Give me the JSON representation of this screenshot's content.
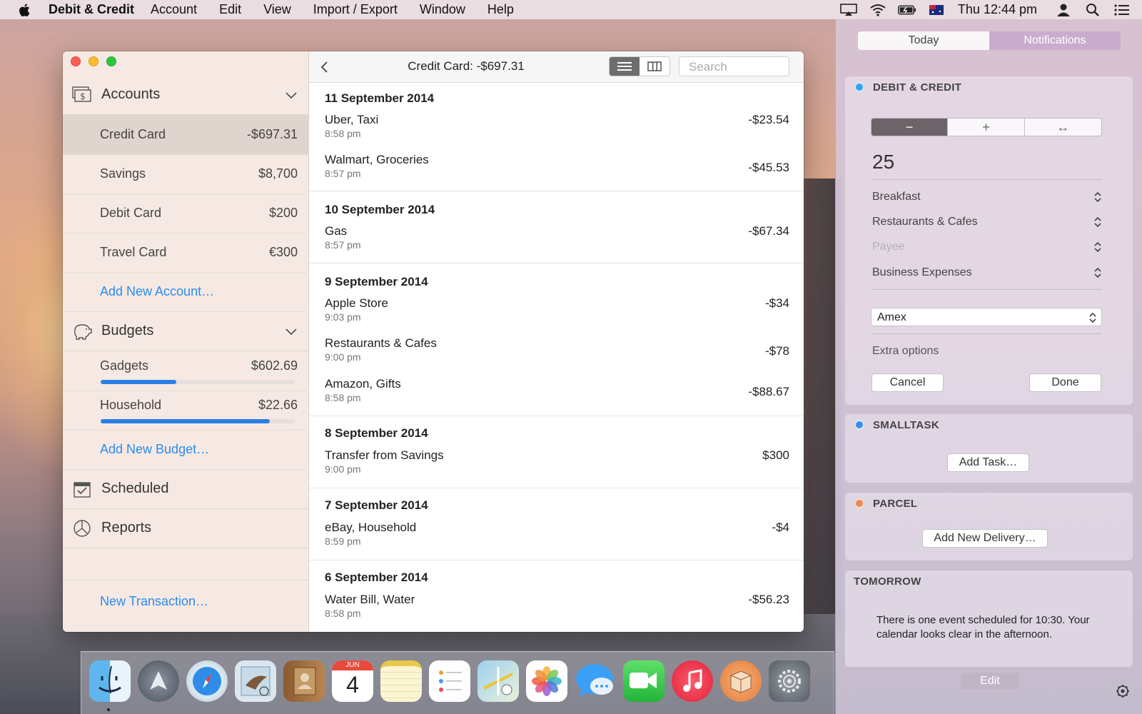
{
  "menubar": {
    "app_name": "Debit & Credit",
    "menus": [
      "Account",
      "Edit",
      "View",
      "Import / Export",
      "Window",
      "Help"
    ],
    "clock": "Thu 12:44 pm"
  },
  "window": {
    "title": "Credit Card: -$697.31",
    "search_placeholder": "Search"
  },
  "sidebar": {
    "accounts_title": "Accounts",
    "accounts": [
      {
        "label": "Credit Card",
        "amount": "-$697.31"
      },
      {
        "label": "Savings",
        "amount": "$8,700"
      },
      {
        "label": "Debit Card",
        "amount": "$200"
      },
      {
        "label": "Travel Card",
        "amount": "€300"
      }
    ],
    "add_account": "Add New Account…",
    "budgets_title": "Budgets",
    "budgets": [
      {
        "label": "Gadgets",
        "amount": "$602.69",
        "progress": 0.39
      },
      {
        "label": "Household",
        "amount": "$22.66",
        "progress": 0.87
      }
    ],
    "add_budget": "Add New Budget…",
    "scheduled": "Scheduled",
    "reports": "Reports",
    "new_transaction": "New Transaction…"
  },
  "transactions": [
    {
      "date": "11 September 2014",
      "items": [
        {
          "name": "Uber, Taxi",
          "time": "8:58 pm",
          "amount": "-$23.54"
        },
        {
          "name": "Walmart, Groceries",
          "time": "8:57 pm",
          "amount": "-$45.53"
        }
      ]
    },
    {
      "date": "10 September 2014",
      "items": [
        {
          "name": "Gas",
          "time": "8:57 pm",
          "amount": "-$67.34"
        }
      ]
    },
    {
      "date": "9 September 2014",
      "items": [
        {
          "name": "Apple Store",
          "time": "9:03 pm",
          "amount": "-$34"
        },
        {
          "name": "Restaurants & Cafes",
          "time": "9:00 pm",
          "amount": "-$78"
        },
        {
          "name": "Amazon, Gifts",
          "time": "8:58 pm",
          "amount": "-$88.67"
        }
      ]
    },
    {
      "date": "8 September 2014",
      "items": [
        {
          "name": "Transfer from Savings",
          "time": "9:00 pm",
          "amount": "$300"
        }
      ]
    },
    {
      "date": "7 September 2014",
      "items": [
        {
          "name": "eBay, Household",
          "time": "8:59 pm",
          "amount": "-$4"
        }
      ]
    },
    {
      "date": "6 September 2014",
      "items": [
        {
          "name": "Water Bill, Water",
          "time": "8:58 pm",
          "amount": "-$56.23"
        }
      ]
    }
  ],
  "notification_center": {
    "tab_today": "Today",
    "tab_notifications": "Notifications",
    "debit_credit": {
      "title": "DEBIT & CREDIT",
      "segments": [
        "−",
        "+",
        "↔"
      ],
      "amount": "25",
      "fields": [
        "Breakfast",
        "Restaurants & Cafes",
        "Payee",
        "Business Expenses"
      ],
      "account_select": "Amex",
      "extra_options": "Extra options",
      "cancel": "Cancel",
      "done": "Done"
    },
    "smalltask": {
      "title": "SMALLTASK",
      "button": "Add Task…"
    },
    "parcel": {
      "title": "PARCEL",
      "button": "Add New Delivery…"
    },
    "tomorrow": {
      "title": "TOMORROW",
      "text": "There is one event scheduled for 10:30. Your calendar looks clear in the afternoon."
    },
    "edit": "Edit"
  },
  "dock": {
    "calendar_month": "JUN",
    "calendar_day": "4"
  },
  "colors": {
    "accent_link": "#2a8cf0",
    "budget_bar": "#2a7fe6"
  }
}
